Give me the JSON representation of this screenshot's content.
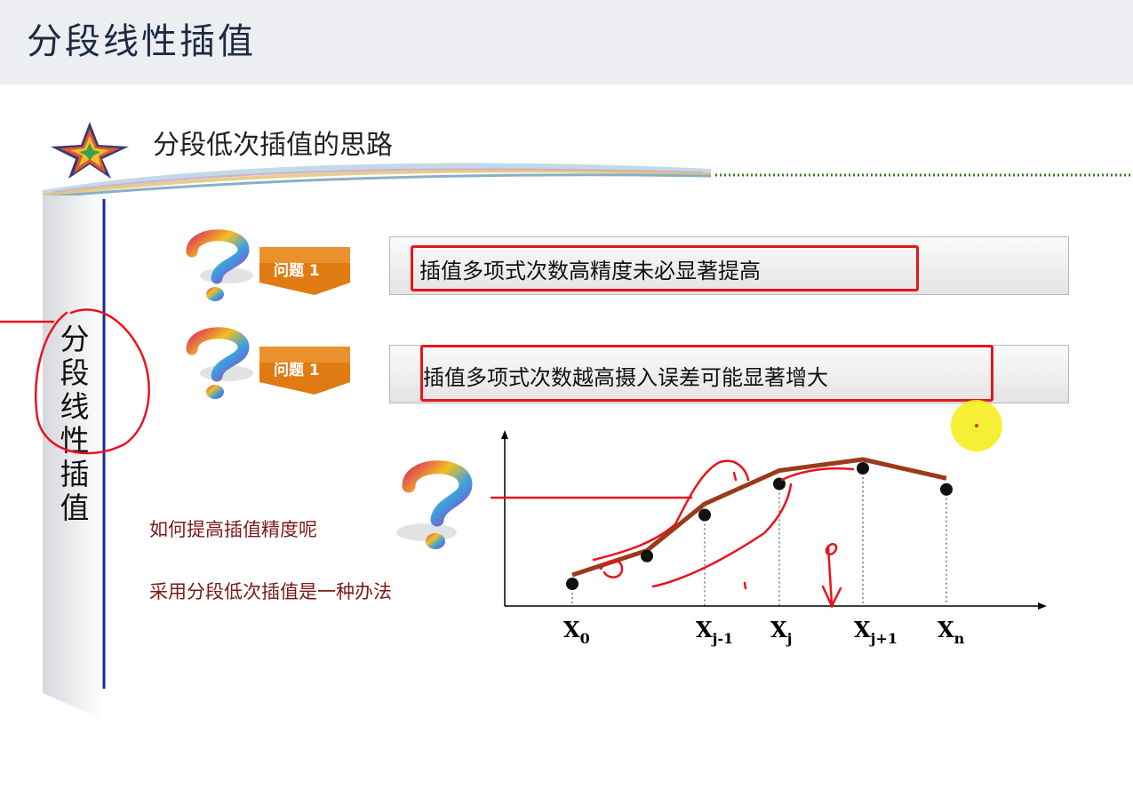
{
  "header": {
    "title": "分段线性插值"
  },
  "section": {
    "title": "分段低次插值的思路"
  },
  "side_panel": {
    "chars": [
      "分",
      "段",
      "线",
      "性",
      "插",
      "值"
    ]
  },
  "questions": [
    {
      "tag": "问题 1",
      "text": "插值多项式次数高精度未必显著提高"
    },
    {
      "tag": "问题 1",
      "text": "插值多项式次数越高摄入误差可能显著增大"
    }
  ],
  "notes": {
    "how_to": "如何提高插值精度呢",
    "answer": "采用分段低次插值是一种办法"
  },
  "chart_data": {
    "type": "line",
    "title": "",
    "xlabel": "",
    "ylabel": "",
    "x_tick_labels": [
      "X0",
      "Xj-1",
      "Xj",
      "Xj+1",
      "Xn"
    ],
    "points": [
      {
        "x": 0,
        "y": 0.2
      },
      {
        "x": 1,
        "y": 0.45
      },
      {
        "x": 2,
        "y": 0.82
      },
      {
        "x": 3,
        "y": 1.1
      },
      {
        "x": 4,
        "y": 1.24
      },
      {
        "x": 5,
        "y": 1.05
      }
    ],
    "polyline": [
      {
        "x": 0,
        "y": 0.28
      },
      {
        "x": 1,
        "y": 0.5
      },
      {
        "x": 2,
        "y": 0.92
      },
      {
        "x": 3,
        "y": 1.22
      },
      {
        "x": 4,
        "y": 1.32
      },
      {
        "x": 5,
        "y": 1.15
      }
    ],
    "colors": {
      "line": "#9a3a1a",
      "points": "#111111"
    }
  },
  "colors": {
    "annotation_red": "#e8141c",
    "tag_orange": "#e07a12",
    "side_bar_blue": "#1a2a9a"
  }
}
